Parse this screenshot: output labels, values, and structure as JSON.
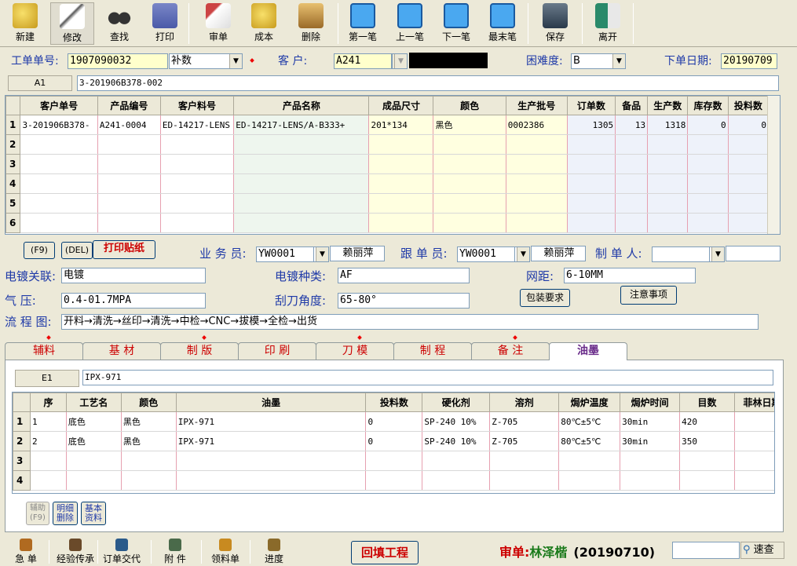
{
  "toolbar": {
    "items": [
      {
        "label": "新建",
        "icon": "new-document-icon"
      },
      {
        "label": "修改",
        "icon": "edit-icon",
        "active": true
      },
      {
        "label": "查找",
        "icon": "binoculars-icon"
      },
      {
        "label": "打印",
        "icon": "print-icon"
      },
      {
        "label": "审单",
        "icon": "review-icon"
      },
      {
        "label": "成本",
        "icon": "cost-icon"
      },
      {
        "label": "删除",
        "icon": "dump-icon"
      },
      {
        "label": "第一笔",
        "icon": "first-record-icon"
      },
      {
        "label": "上一笔",
        "icon": "prev-record-icon"
      },
      {
        "label": "下一笔",
        "icon": "next-record-icon"
      },
      {
        "label": "最末笔",
        "icon": "last-record-icon"
      },
      {
        "label": "保存",
        "icon": "save-icon"
      },
      {
        "label": "离开",
        "icon": "exit-icon"
      }
    ]
  },
  "header": {
    "order_no_label": "工单单号:",
    "order_no": "1907090032",
    "type_value": "补数",
    "customer_label": "客    户:",
    "customer_code": "A241",
    "difficulty_label": "困难度:",
    "difficulty": "B",
    "date_label": "下单日期:",
    "date": "20190709"
  },
  "nav": {
    "cell": "A1",
    "value": "3-201906B378-002"
  },
  "main_grid": {
    "columns": [
      "客户单号",
      "产品编号",
      "客户料号",
      "产品名称",
      "成品尺寸",
      "颜色",
      "生产批号",
      "订单数",
      "备品",
      "生产数",
      "库存数",
      "投料数"
    ],
    "rows": [
      {
        "n": "1",
        "cells": [
          "3-201906B378-",
          "A241-0004",
          "ED-14217-LENS",
          "ED-14217-LENS/A-B333+",
          "201*134",
          "黑色",
          "0002386",
          "1305",
          "13",
          "1318",
          "0",
          "0"
        ]
      },
      {
        "n": "2",
        "cells": [
          "",
          "",
          "",
          "",
          "",
          "",
          "",
          "",
          "",
          "",
          "",
          ""
        ]
      },
      {
        "n": "3",
        "cells": [
          "",
          "",
          "",
          "",
          "",
          "",
          "",
          "",
          "",
          "",
          "",
          ""
        ]
      },
      {
        "n": "4",
        "cells": [
          "",
          "",
          "",
          "",
          "",
          "",
          "",
          "",
          "",
          "",
          "",
          ""
        ]
      },
      {
        "n": "5",
        "cells": [
          "",
          "",
          "",
          "",
          "",
          "",
          "",
          "",
          "",
          "",
          "",
          ""
        ]
      },
      {
        "n": "6",
        "cells": [
          "",
          "",
          "",
          "",
          "",
          "",
          "",
          "",
          "",
          "",
          "",
          ""
        ]
      }
    ]
  },
  "mid": {
    "f9": "(F9)",
    "del": "(DEL)",
    "print_label": "打印贴纸",
    "sales_label": "业 务 员:",
    "sales_code": "YW0001",
    "sales_name": "赖丽萍",
    "follow_label": "跟 单 员:",
    "follow_code": "YW0001",
    "follow_name": "赖丽萍",
    "maker_label": "制 单 人:",
    "maker_code": "",
    "maker_name": "",
    "plating_label": "电镀关联:",
    "plating_value": "电镀",
    "plating_type_label": "电镀种类:",
    "plating_type_value": "AF",
    "mesh_label": "网距:",
    "mesh_value": "6-10MM",
    "pressure_label": "气    压:",
    "pressure_value": "0.4-01.7MPA",
    "blade_label": "刮刀角度:",
    "blade_value": "65-80°",
    "pack_btn": "包装要求",
    "notes_btn": "注意事项",
    "flow_label": "流 程 图:",
    "flow_value": "开料→清洗→丝印→清洗→中检→CNC→拔模→全检→出货"
  },
  "tabs": [
    "辅料",
    "基 材",
    "制 版",
    "印 刷",
    "刀 模",
    "制 程",
    "备 注",
    "油墨"
  ],
  "ink": {
    "cell": "E1",
    "value": "IPX-971",
    "columns": [
      "序",
      "工艺名",
      "颜色",
      "油墨",
      "投料数",
      "硬化剂",
      "溶剂",
      "焗炉温度",
      "焗炉时间",
      "目数",
      "菲林日期"
    ],
    "rows": [
      {
        "n": "1",
        "cells": [
          "1",
          "底色",
          "黑色",
          "IPX-971",
          "0",
          "SP-240   10%",
          "Z-705",
          "80℃±5℃",
          "30min",
          "420",
          ""
        ]
      },
      {
        "n": "2",
        "cells": [
          "2",
          "底色",
          "黑色",
          "IPX-971",
          "0",
          "SP-240   10%",
          "Z-705",
          "80℃±5℃",
          "30min",
          "350",
          ""
        ]
      },
      {
        "n": "3",
        "cells": [
          "",
          "",
          "",
          "",
          "",
          "",
          "",
          "",
          "",
          "",
          ""
        ]
      },
      {
        "n": "4",
        "cells": [
          "",
          "",
          "",
          "",
          "",
          "",
          "",
          "",
          "",
          "",
          ""
        ]
      }
    ],
    "aux_btn": "辅助(F9)",
    "del_btn": "明细删除",
    "base_btn": "基本资料"
  },
  "bottom": {
    "items": [
      {
        "label": "急 单",
        "icon": "urgent-icon"
      },
      {
        "label": "经验传承",
        "icon": "experience-icon"
      },
      {
        "label": "订单交代",
        "icon": "order-note-icon"
      },
      {
        "label": "附 件",
        "icon": "attachment-icon"
      },
      {
        "label": "领料单",
        "icon": "material-icon"
      },
      {
        "label": "进度",
        "icon": "progress-icon"
      }
    ],
    "refill_btn": "回填工程",
    "audit_prefix": "审单:",
    "audit_name": "林泽楷",
    "audit_date": "(20190710)",
    "quick_search": "速查"
  }
}
